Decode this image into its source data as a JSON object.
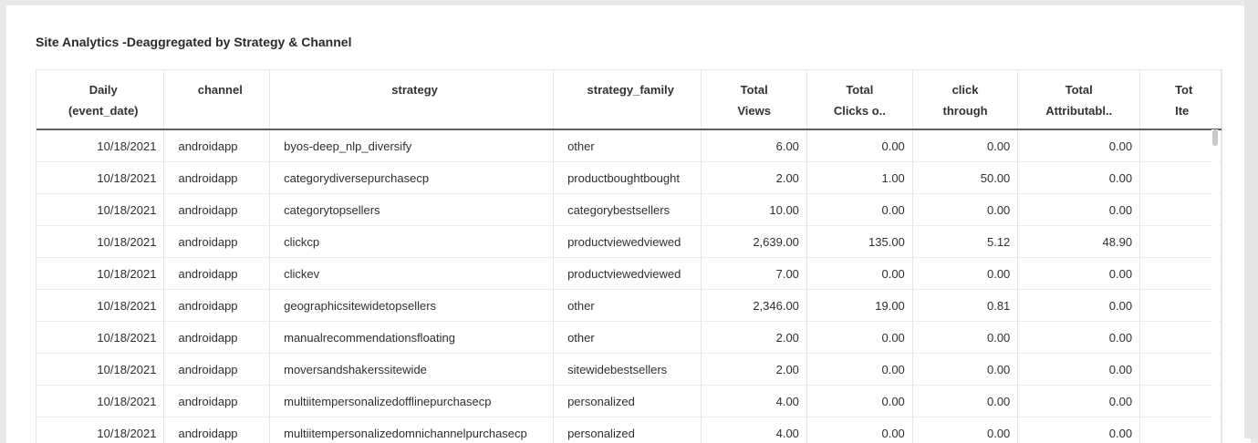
{
  "widget": {
    "title": "Site Analytics -Deaggregated by Strategy & Channel"
  },
  "table": {
    "headers": [
      {
        "line1": "Daily",
        "line2": "(event_date)"
      },
      {
        "line1": "channel",
        "line2": ""
      },
      {
        "line1": "strategy",
        "line2": ""
      },
      {
        "line1": "strategy_family",
        "line2": ""
      },
      {
        "line1": "Total",
        "line2": "Views"
      },
      {
        "line1": "Total",
        "line2": "Clicks o.."
      },
      {
        "line1": "click",
        "line2": "through"
      },
      {
        "line1": "Total",
        "line2": "Attributabl.."
      },
      {
        "line1": "Tot",
        "line2": "Ite"
      }
    ],
    "rows": [
      [
        "10/18/2021",
        "androidapp",
        "byos-deep_nlp_diversify",
        "other",
        "6.00",
        "0.00",
        "0.00",
        "0.00",
        ""
      ],
      [
        "10/18/2021",
        "androidapp",
        "categorydiversepurchasecp",
        "productboughtbought",
        "2.00",
        "1.00",
        "50.00",
        "0.00",
        ""
      ],
      [
        "10/18/2021",
        "androidapp",
        "categorytopsellers",
        "categorybestsellers",
        "10.00",
        "0.00",
        "0.00",
        "0.00",
        ""
      ],
      [
        "10/18/2021",
        "androidapp",
        "clickcp",
        "productviewedviewed",
        "2,639.00",
        "135.00",
        "5.12",
        "48.90",
        ""
      ],
      [
        "10/18/2021",
        "androidapp",
        "clickev",
        "productviewedviewed",
        "7.00",
        "0.00",
        "0.00",
        "0.00",
        ""
      ],
      [
        "10/18/2021",
        "androidapp",
        "geographicsitewidetopsellers",
        "other",
        "2,346.00",
        "19.00",
        "0.81",
        "0.00",
        ""
      ],
      [
        "10/18/2021",
        "androidapp",
        "manualrecommendationsfloating",
        "other",
        "2.00",
        "0.00",
        "0.00",
        "0.00",
        ""
      ],
      [
        "10/18/2021",
        "androidapp",
        "moversandshakerssitewide",
        "sitewidebestsellers",
        "2.00",
        "0.00",
        "0.00",
        "0.00",
        ""
      ],
      [
        "10/18/2021",
        "androidapp",
        "multiitempersonalizedofflinepurchasecp",
        "personalized",
        "4.00",
        "0.00",
        "0.00",
        "0.00",
        ""
      ],
      [
        "10/18/2021",
        "androidapp",
        "multiitempersonalizedomnichannelpurchasecp",
        "personalized",
        "4.00",
        "0.00",
        "0.00",
        "0.00",
        ""
      ]
    ]
  }
}
